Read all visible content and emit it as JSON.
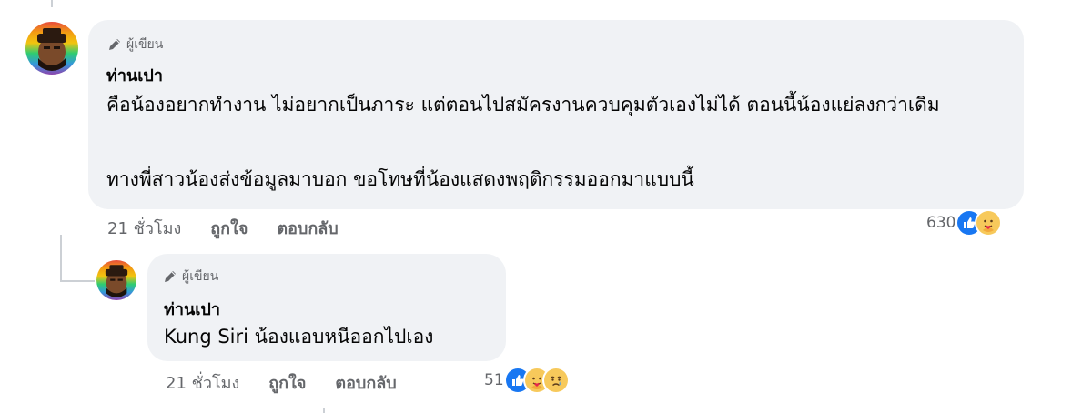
{
  "comments": [
    {
      "badge": "ผู้เขียน",
      "author": "ท่านเปา",
      "paragraph1": "คือน้องอยากทำงาน ไม่อยากเป็นภาระ แต่ตอนไปสมัครงานควบคุมตัวเองไม่ได้ ตอนนี้น้องแย่ลงกว่าเดิม",
      "paragraph2": "ทางพี่สาวน้องส่งข้อมูลมาบอก ขอโทษที่น้องแสดงพฤติกรรมออกมาแบบนี้",
      "time": "21 ชั่วโมง",
      "like_action": "ถูกใจ",
      "reply_action": "ตอบกลับ",
      "reaction_count": "630",
      "reactions": [
        "like-icon",
        "care-icon"
      ]
    },
    {
      "badge": "ผู้เขียน",
      "author": "ท่านเปา",
      "paragraph1": "Kung Siri น้องแอบหนีออกไปเอง",
      "time": "21 ชั่วโมง",
      "like_action": "ถูกใจ",
      "reply_action": "ตอบกลับ",
      "reaction_count": "51",
      "reactions": [
        "like-icon",
        "care-icon",
        "sad-icon"
      ]
    }
  ]
}
